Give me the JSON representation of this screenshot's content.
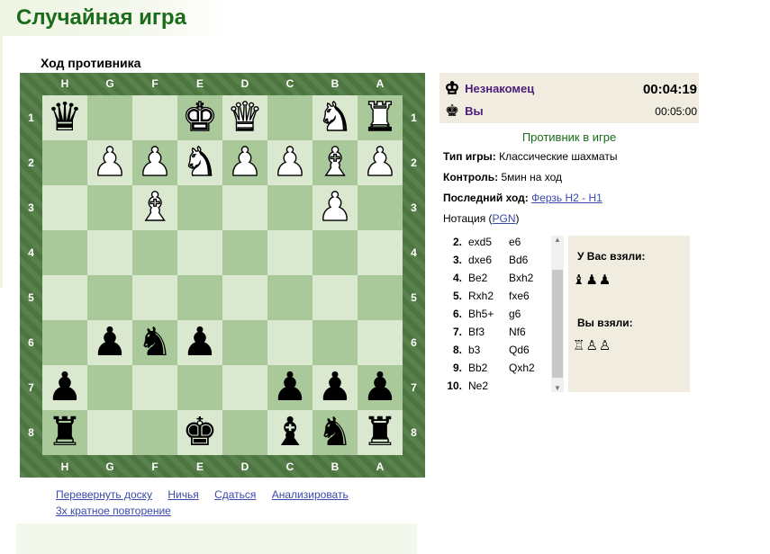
{
  "page": {
    "title": "Случайная игра",
    "turn_label": "Ход противника"
  },
  "board": {
    "files": [
      "H",
      "G",
      "F",
      "E",
      "D",
      "C",
      "B",
      "A"
    ],
    "ranks": [
      "1",
      "2",
      "3",
      "4",
      "5",
      "6",
      "7",
      "8"
    ],
    "pieces": [
      [
        "bq",
        "",
        "",
        "wk",
        "wq",
        "",
        "wn",
        "wr"
      ],
      [
        "",
        "wp",
        "wp",
        "wn",
        "wp",
        "wp",
        "wb",
        "wp"
      ],
      [
        "",
        "",
        "wb",
        "",
        "",
        "",
        "wp",
        ""
      ],
      [
        "",
        "",
        "",
        "",
        "",
        "",
        "",
        ""
      ],
      [
        "",
        "",
        "",
        "",
        "",
        "",
        "",
        ""
      ],
      [
        "",
        "bp",
        "bn",
        "bp",
        "",
        "",
        "",
        ""
      ],
      [
        "bp",
        "",
        "",
        "",
        "",
        "bp",
        "bp",
        "bp"
      ],
      [
        "br",
        "",
        "",
        "bk",
        "",
        "bb",
        "bn",
        "br"
      ]
    ]
  },
  "players": {
    "opponent": {
      "name": "Незнакомец",
      "clock": "00:04:19"
    },
    "me": {
      "name": "Вы",
      "clock": "00:05:00"
    }
  },
  "status": "Противник в игре",
  "game_info": {
    "type_label": "Тип игры:",
    "type_value": "Классические шахматы",
    "control_label": "Контроль:",
    "control_value": "5мин на ход",
    "last_move_label": "Последний ход:",
    "last_move_value": "Ферзь H2 - H1",
    "notation_prefix": "Нотация (",
    "notation_link": "PGN",
    "notation_suffix": ")"
  },
  "moves": [
    {
      "n": "2.",
      "w": "exd5",
      "b": "e6"
    },
    {
      "n": "3.",
      "w": "dxe6",
      "b": "Bd6"
    },
    {
      "n": "4.",
      "w": "Be2",
      "b": "Bxh2"
    },
    {
      "n": "5.",
      "w": "Rxh2",
      "b": "fxe6"
    },
    {
      "n": "6.",
      "w": "Bh5+",
      "b": "g6"
    },
    {
      "n": "7.",
      "w": "Bf3",
      "b": "Nf6"
    },
    {
      "n": "8.",
      "w": "b3",
      "b": "Qd6"
    },
    {
      "n": "9.",
      "w": "Bb2",
      "b": "Qxh2"
    },
    {
      "n": "10.",
      "w": "Ne2",
      "b": ""
    }
  ],
  "captured": {
    "taken_from_you_label": "У Вас взяли:",
    "taken_from_you": "♝♟♟",
    "you_took_label": "Вы взяли:",
    "you_took": "♖♙♙"
  },
  "actions": {
    "flip": "Перевернуть доску",
    "draw": "Ничья",
    "resign": "Сдаться",
    "analyze": "Анализировать",
    "threefold": "3х кратное повторение"
  },
  "colors": {
    "title": "#1a6b1a",
    "board_frame": "#4f7a43",
    "light_square": "#d9e8cf",
    "dark_square": "#a9c99b",
    "link": "#3949ab",
    "panel_bg": "#f1ece0"
  }
}
